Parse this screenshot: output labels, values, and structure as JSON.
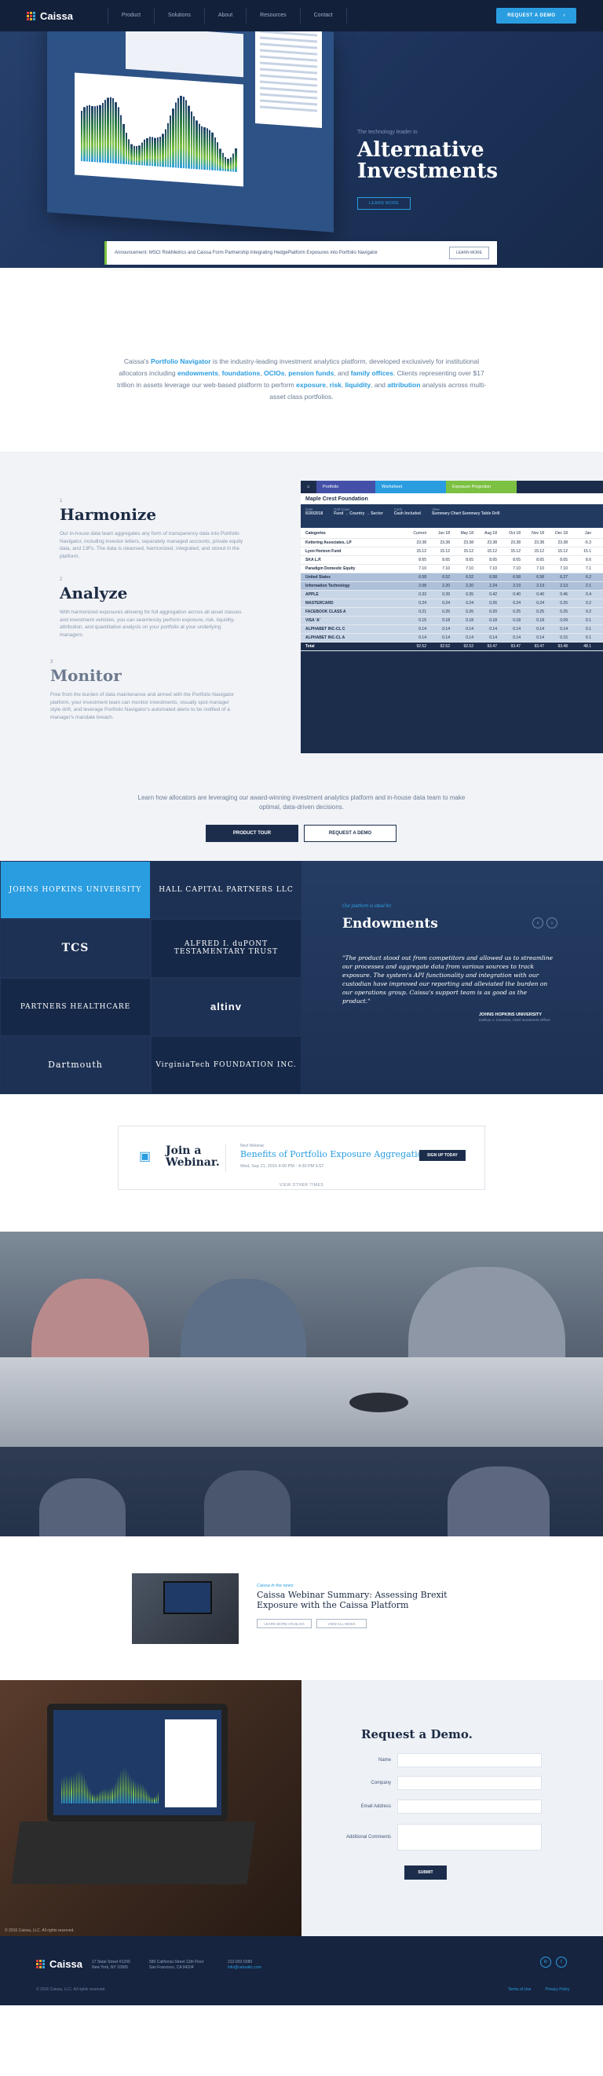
{
  "nav": {
    "brand": "Caissa",
    "links": [
      "Product",
      "Solutions",
      "About",
      "Resources",
      "Contact"
    ],
    "cta": "REQUEST A DEMO",
    "cta_arrow": "›"
  },
  "hero": {
    "kicker": "The technology leader in",
    "title_line1": "Alternative",
    "title_line2": "Investments",
    "button": "LEARN MORE"
  },
  "announcement": {
    "text": "Announcement: MSCI RiskMetrics and Caissa Form Partnership Integrating HedgePlatform Exposures into Portfolio Navigator",
    "button": "LEARN MORE"
  },
  "intro": {
    "p1": "Caissa's ",
    "product": "Portfolio Navigator",
    "p2": " is the industry-leading investment analytics platform, developed exclusively for institutional allocators including ",
    "k1": "endowments",
    "k2": "foundations",
    "k3": "OCIOs",
    "k4": "pension funds",
    "k5": "family offices",
    "p3": ". Clients representing over $17 trillion in assets leverage our web-based platform to perform ",
    "k6": "exposure",
    "k7": "risk",
    "k8": "liquidity",
    "k9": "attribution",
    "p4": " analysis across multi-asset class portfolios."
  },
  "features": {
    "items": [
      {
        "num": "1",
        "title": "Harmonize",
        "text": "Our in-house data team aggregates any form of transparency data into Portfolio Navigator, including investor letters, separately managed accounts, private equity data, and 13Fs. The data is cleansed, harmonized, integrated, and stored in the platform."
      },
      {
        "num": "2",
        "title": "Analyze",
        "text": "With harmonized exposures allowing for full aggregation across all asset classes and investment vehicles, you can seamlessly perform exposure, risk, liquidity, attribution, and quantitative analysis on your portfolio at your underlying managers."
      },
      {
        "num": "3",
        "title": "Monitor",
        "text": "Free from the burden of data maintenance and armed with the Portfolio Navigator platform, your investment team can monitor investments, visually spot manager style drift, and leverage Portfolio Navigator's automated alerts to be notified of a manager's mandate breach."
      }
    ],
    "grid": {
      "tabs": [
        "Portfolio",
        "Worksheet",
        "Exposure Projection"
      ],
      "title": "Maple Crest Foundation",
      "head": [
        {
          "label": "Date",
          "value": "6/30/2018"
        },
        {
          "label": "Drill Down",
          "value": "Fund → Country → Sector"
        },
        {
          "label": "Cash",
          "value": "Cash Included"
        },
        {
          "label": "View",
          "value": "Summary Chart   Summary Table   Drill"
        }
      ],
      "columns": [
        "Categories",
        "Current",
        "Jun 18",
        "May 18",
        "Aug 18",
        "Oct 18",
        "Nov 18",
        "Dec 18",
        "Jan"
      ],
      "rows": [
        {
          "name": "Kettering Associates, LP",
          "vals": [
            "23.38",
            "23.38",
            "23.38",
            "23.38",
            "23.38",
            "23.38",
            "23.38",
            "-5.3"
          ],
          "style": ""
        },
        {
          "name": "Lyon Horizon Fund",
          "vals": [
            "15.12",
            "15.12",
            "15.12",
            "15.12",
            "15.12",
            "15.12",
            "15.12",
            "15.1"
          ],
          "style": ""
        },
        {
          "name": "SKA L.P.",
          "vals": [
            "8.65",
            "8.65",
            "8.65",
            "8.65",
            "8.65",
            "8.65",
            "8.65",
            "8.6"
          ],
          "style": ""
        },
        {
          "name": "Paradigm Domestic Equity",
          "vals": [
            "7.10",
            "7.10",
            "7.10",
            "7.10",
            "7.10",
            "7.10",
            "7.10",
            "7.1"
          ],
          "style": ""
        },
        {
          "name": "United States",
          "vals": [
            "6.58",
            "6.52",
            "6.52",
            "6.58",
            "6.58",
            "6.58",
            "6.27",
            "6.2"
          ],
          "style": "sub"
        },
        {
          "name": "Information Technology",
          "vals": [
            "2.08",
            "2.20",
            "2.20",
            "2.24",
            "2.19",
            "2.19",
            "2.13",
            "2.1"
          ],
          "style": "sub"
        },
        {
          "name": "APPLE",
          "vals": [
            "0.33",
            "0.39",
            "0.35",
            "0.42",
            "0.40",
            "0.40",
            "0.46",
            "0.4"
          ],
          "style": "sub2"
        },
        {
          "name": "MASTERCARD",
          "vals": [
            "0.24",
            "0.24",
            "0.24",
            "0.26",
            "0.24",
            "0.24",
            "0.25",
            "0.2"
          ],
          "style": "sub2"
        },
        {
          "name": "FACEBOOK CLASS A",
          "vals": [
            "0.21",
            "0.26",
            "0.26",
            "0.20",
            "0.25",
            "0.25",
            "0.25",
            "0.2"
          ],
          "style": "sub2"
        },
        {
          "name": "VISA 'A'",
          "vals": [
            "0.15",
            "0.18",
            "0.18",
            "0.18",
            "0.18",
            "0.18",
            "0.09",
            "0.1"
          ],
          "style": "sub2"
        },
        {
          "name": "ALPHABET INC-CL C",
          "vals": [
            "0.14",
            "0.14",
            "0.14",
            "0.14",
            "0.14",
            "0.14",
            "0.14",
            "0.1"
          ],
          "style": "sub2"
        },
        {
          "name": "ALPHABET INC-CL A",
          "vals": [
            "0.14",
            "0.14",
            "0.14",
            "0.14",
            "0.14",
            "0.14",
            "0.15",
            "0.1"
          ],
          "style": "sub2"
        },
        {
          "name": "Total",
          "vals": [
            "92.52",
            "92.52",
            "92.52",
            "93.47",
            "93.47",
            "93.47",
            "93.48",
            "48.1"
          ],
          "style": "tot"
        }
      ]
    },
    "cta_text_line1": "Learn how allocators are leveraging our award-winning investment analytics platform and in-house data team to make",
    "cta_text_line2": "optimal, data-driven decisions.",
    "product_tour": "PRODUCT TOUR",
    "request_demo": "REQUEST A DEMO"
  },
  "clients": {
    "logos": [
      "JOHNS HOPKINS UNIVERSITY",
      "HALL CAPITAL PARTNERS LLC",
      "TCS",
      "ALFRED I. duPONT TESTAMENTARY TRUST",
      "PARTNERS HEALTHCARE",
      "altinv",
      "Dartmouth",
      "VirginiaTech FOUNDATION INC."
    ],
    "testimonial": {
      "kicker": "Our platform is ideal for",
      "title": "Endowments",
      "quote": "\"The product stood out from competitors and allowed us to streamline our processes and aggregate data from various sources to track exposure. The system's API functionality and integration with our custodian have improved our reporting and alleviated the burden on our operations group. Caissa's support team is as good as the product.\"",
      "author": "JOHNS HOPKINS UNIVERSITY",
      "role": "Kathryn J. Crecelius, Chief Investment Officer",
      "prev": "‹",
      "next": "›"
    }
  },
  "webinar": {
    "icon": "screen-icon",
    "join": "Join a Webinar.",
    "kicker": "Next Webinar",
    "title": "Benefits of Portfolio Exposure Aggregation",
    "date": "Wed, Sep 21, 2016 4:00 PM - 4:30 PM EST",
    "button": "SIGN UP TODAY",
    "view_all": "VIEW OTHER TIMES"
  },
  "news": {
    "kicker": "Caissa in the news:",
    "title": "Caissa Webinar Summary: Assessing Brexit Exposure with the Caissa Platform",
    "btn1": "LEARN MORE ON BLOG",
    "btn2": "VIEW ALL NEWS"
  },
  "demo": {
    "title": "Request a Demo.",
    "fields": [
      "Name",
      "Company",
      "Email Address",
      "Additional Comments"
    ],
    "submit": "SUBMIT",
    "copyright": "© 2016 Caissa, LLC. All rights reserved."
  },
  "footer": {
    "brand": "Caissa",
    "addr1_line1": "17 State Street #1200",
    "addr1_line2": "New York, NY 10005",
    "addr2_line1": "580 California Street 12th Floor",
    "addr2_line2": "San Francisco, CA 94104",
    "phone": "212-932-0380",
    "email": "info@caissallc.com",
    "social1": "in",
    "social2": "t",
    "copyright": "© 2016 Caissa, LLC. All rights reserved.",
    "link1": "Terms of Use",
    "link2": "Privacy Policy"
  },
  "colors": {
    "navy": "#12203a",
    "accent": "#2a9de0",
    "green": "#7cc142"
  }
}
